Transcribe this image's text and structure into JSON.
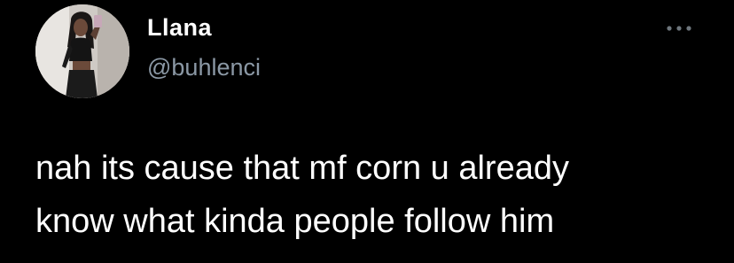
{
  "user": {
    "display_name": "Llana",
    "handle": "@buhlenci"
  },
  "tweet": {
    "text_line_1": "nah its cause that mf corn u already",
    "text_line_2": "know what kinda people follow him"
  },
  "icons": {
    "avatar": "profile-photo",
    "more": "more-horizontal-icon"
  },
  "colors": {
    "background": "#000000",
    "text": "#ffffff",
    "secondary_text": "#8b98a5",
    "icon": "#6e767d"
  }
}
